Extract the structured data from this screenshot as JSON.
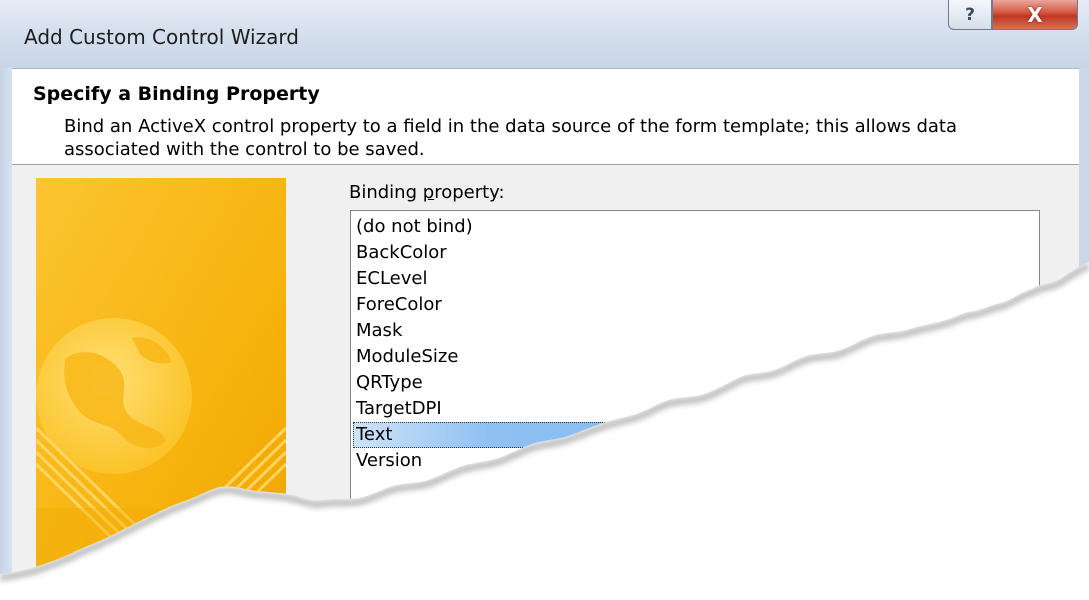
{
  "window": {
    "title": "Add Custom Control Wizard",
    "help_glyph": "?",
    "close_glyph": "X"
  },
  "header": {
    "title": "Specify a Binding Property",
    "description": "Bind an ActiveX control property to a field in the data source of the form template; this allows data associated with the control to be saved."
  },
  "binding": {
    "label_prefix": "Binding ",
    "label_accel": "p",
    "label_suffix": "roperty:",
    "options": [
      "(do not bind)",
      "BackColor",
      "ECLevel",
      "ForeColor",
      "Mask",
      "ModuleSize",
      "QRType",
      "TargetDPI",
      "Text",
      "Version"
    ],
    "selected": "Text"
  },
  "colors": {
    "selection": "#7eb4ea",
    "wizard_image": "#f9b712",
    "close_button": "#c94a34"
  },
  "icons": [
    "help-icon",
    "close-icon",
    "globe-icon"
  ]
}
